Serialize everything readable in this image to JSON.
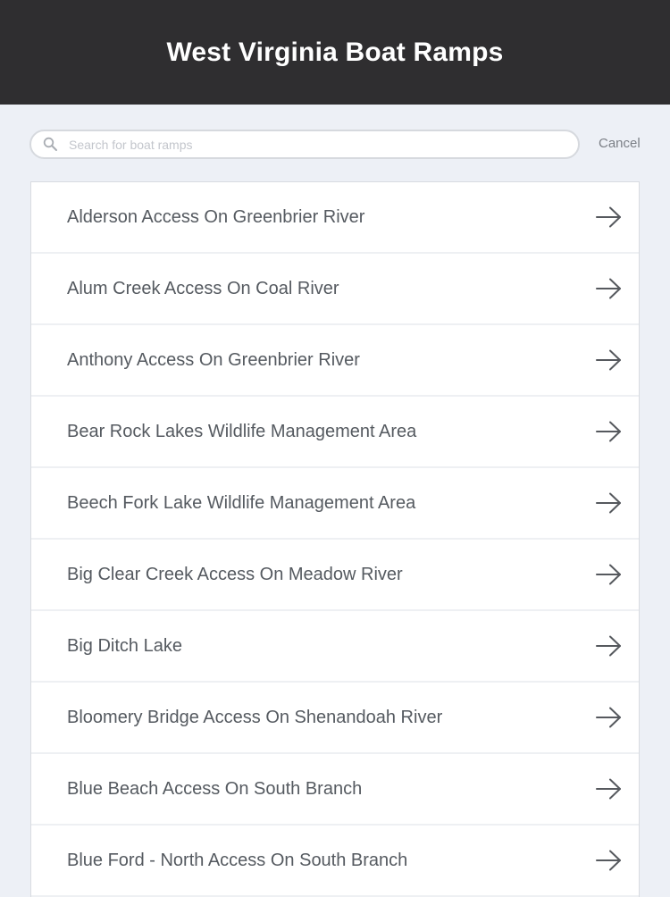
{
  "header": {
    "title": "West Virginia Boat Ramps"
  },
  "search": {
    "placeholder": "Search for boat ramps",
    "value": "",
    "cancel_label": "Cancel"
  },
  "list": {
    "items": [
      {
        "label": "Alderson Access On Greenbrier River"
      },
      {
        "label": "Alum Creek Access On Coal River"
      },
      {
        "label": "Anthony Access On Greenbrier River"
      },
      {
        "label": "Bear Rock Lakes Wildlife Management Area"
      },
      {
        "label": "Beech Fork Lake Wildlife Management Area"
      },
      {
        "label": "Big Clear Creek Access On Meadow River"
      },
      {
        "label": "Big Ditch Lake"
      },
      {
        "label": "Bloomery Bridge Access On Shenandoah River"
      },
      {
        "label": "Blue Beach Access On South Branch"
      },
      {
        "label": "Blue Ford - North Access On South Branch"
      }
    ]
  },
  "icons": {
    "search": "search-icon",
    "row_arrow": "arrow-right-icon"
  },
  "colors": {
    "header_bg": "#2f2e30",
    "page_bg": "#edf0f6",
    "text": "#555a60",
    "cancel": "#7b7f86"
  }
}
